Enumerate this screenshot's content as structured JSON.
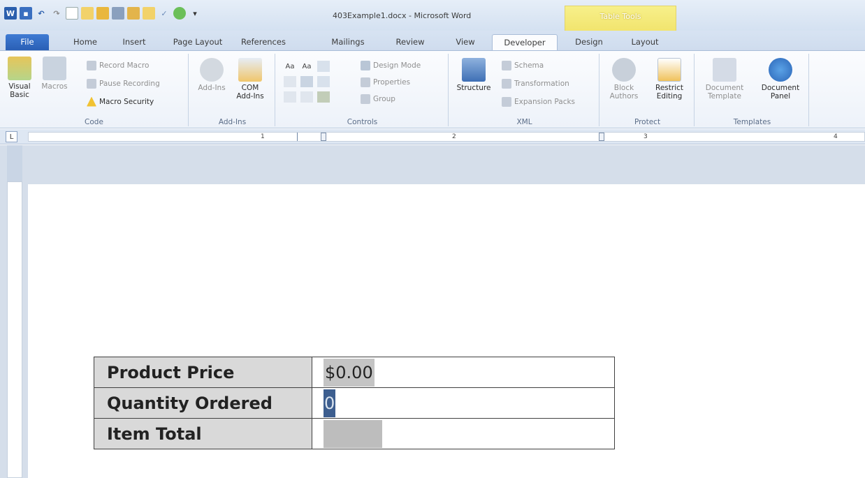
{
  "window": {
    "title": "403Example1.docx - Microsoft Word"
  },
  "context_tab": {
    "label": "Table Tools"
  },
  "tabs": [
    "File",
    "Home",
    "Insert",
    "Page Layout",
    "References",
    "Mailings",
    "Review",
    "View",
    "Developer",
    "Design",
    "Layout"
  ],
  "active_tab": "Developer",
  "ribbon": {
    "code": {
      "group_label": "Code",
      "visual_basic": "Visual Basic",
      "macros": "Macros",
      "record_macro": "Record Macro",
      "pause_recording": "Pause Recording",
      "macro_security": "Macro Security"
    },
    "addins": {
      "group_label": "Add-Ins",
      "addins": "Add-Ins",
      "com_addins": "COM Add-Ins"
    },
    "controls": {
      "group_label": "Controls",
      "design_mode": "Design Mode",
      "properties": "Properties",
      "group": "Group",
      "aa1": "Aa",
      "aa2": "Aa"
    },
    "xml": {
      "group_label": "XML",
      "structure": "Structure",
      "schema": "Schema",
      "transformation": "Transformation",
      "expansion_packs": "Expansion Packs"
    },
    "protect": {
      "group_label": "Protect",
      "block_authors": "Block Authors",
      "restrict_editing": "Restrict Editing"
    },
    "templates": {
      "group_label": "Templates",
      "document_template": "Document Template",
      "document_panel": "Document Panel"
    }
  },
  "ruler": {
    "marks": [
      "1",
      "2",
      "3",
      "4"
    ]
  },
  "table": {
    "rows": [
      {
        "label": "Product Price",
        "value": "$0.00"
      },
      {
        "label": "Quantity Ordered",
        "value": "0"
      },
      {
        "label": "Item Total",
        "value": ""
      }
    ]
  },
  "colors": {
    "file_tab": "#2a5fb5",
    "context_tab": "#f1e36b",
    "ribbon": "#edf2f9",
    "selection": "#3d5e8f"
  }
}
